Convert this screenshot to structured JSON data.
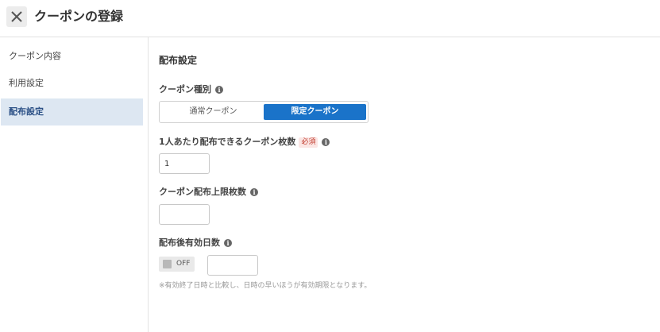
{
  "header": {
    "title": "クーポンの登録"
  },
  "sidebar": {
    "items": [
      {
        "label": "クーポン内容"
      },
      {
        "label": "利用設定"
      },
      {
        "label": "配布設定"
      }
    ],
    "active_index": 2
  },
  "main": {
    "section_title": "配布設定",
    "coupon_type": {
      "label": "クーポン種別",
      "options": [
        "通常クーポン",
        "限定クーポン"
      ],
      "selected": "限定クーポン"
    },
    "per_person": {
      "label": "1人あたり配布できるクーポン枚数",
      "required_badge": "必須",
      "value": "1"
    },
    "limit": {
      "label": "クーポン配布上限枚数",
      "value": ""
    },
    "valid_days": {
      "label": "配布後有効日数",
      "toggle_label": "OFF",
      "value": ""
    },
    "note": "※有効終了日時と比較し、日時の早いほうが有効期限となります。"
  },
  "colors": {
    "accent": "#1a73c9",
    "sidebar_active": "#dde7f2",
    "required": "#c0392b"
  },
  "icons": {
    "close": "close-icon",
    "info": "info-icon"
  }
}
